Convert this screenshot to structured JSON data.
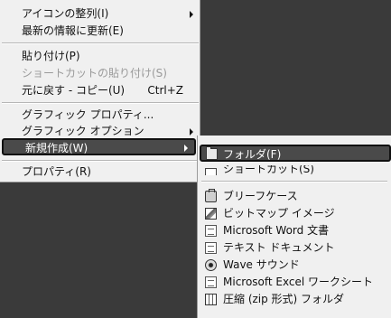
{
  "context_menu": {
    "items": [
      {
        "label": "アイコンの整列(I)",
        "has_submenu": true
      },
      {
        "label": "最新の情報に更新(E)"
      },
      {
        "label": "貼り付け(P)"
      },
      {
        "label": "ショートカットの貼り付け(S)",
        "disabled": true
      },
      {
        "label": "元に戻す - コピー(U)",
        "shortcut": "Ctrl+Z"
      },
      {
        "label": "グラフィック プロパティ..."
      },
      {
        "label": "グラフィック オプション",
        "has_submenu": true
      },
      {
        "label": "新規作成(W)",
        "highlighted": true,
        "has_submenu": true
      },
      {
        "label": "プロパティ(R)"
      }
    ]
  },
  "new_submenu": {
    "items": [
      {
        "label": "フォルダ(F)",
        "icon": "folder-icon",
        "highlighted": true
      },
      {
        "label": "ショートカット(S)",
        "icon": "shortcut-icon"
      },
      {
        "label": "ブリーフケース",
        "icon": "briefcase-icon"
      },
      {
        "label": "ビットマップ イメージ",
        "icon": "bitmap-image-icon"
      },
      {
        "label": "Microsoft Word 文書",
        "icon": "word-document-icon"
      },
      {
        "label": "テキスト ドキュメント",
        "icon": "text-document-icon"
      },
      {
        "label": "Wave サウンド",
        "icon": "wave-sound-icon"
      },
      {
        "label": "Microsoft Excel ワークシート",
        "icon": "excel-worksheet-icon"
      },
      {
        "label": "圧縮 (zip 形式) フォルダ",
        "icon": "zip-folder-icon"
      }
    ]
  }
}
